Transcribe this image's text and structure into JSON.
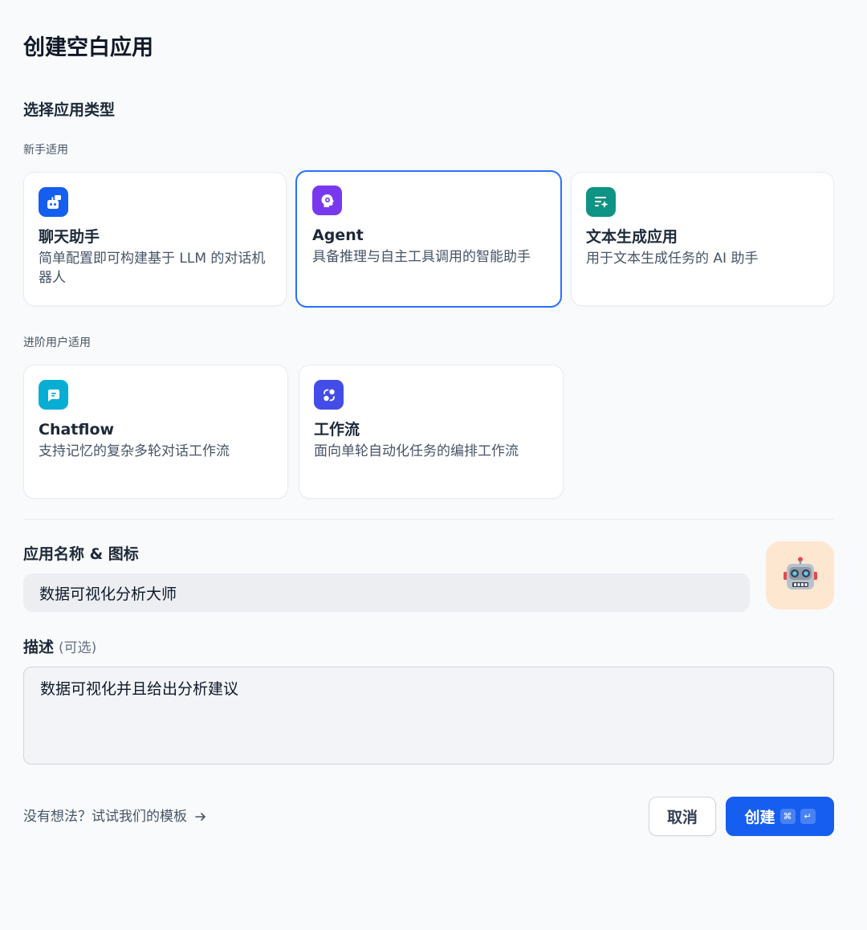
{
  "dialog": {
    "title": "创建空白应用",
    "section_title": "选择应用类型"
  },
  "groups": {
    "beginner": "新手适用",
    "advanced": "进阶用户适用"
  },
  "cards": {
    "chat": {
      "title": "聊天助手",
      "desc": "简单配置即可构建基于 LLM 的对话机器人",
      "icon_color": "#155eef",
      "icon": "robot-chat-icon"
    },
    "agent": {
      "title": "Agent",
      "desc": "具备推理与自主工具调用的智能助手",
      "icon_color": "#7839ee",
      "icon": "brain-gear-icon",
      "selected": true
    },
    "completion": {
      "title": "文本生成应用",
      "desc": "用于文本生成任务的 AI 助手",
      "icon_color": "#0e9384",
      "icon": "text-sparkle-icon"
    },
    "chatflow": {
      "title": "Chatflow",
      "desc": "支持记忆的复杂多轮对话工作流",
      "icon_color": "#06aed4",
      "icon": "chat-bubble-icon"
    },
    "workflow": {
      "title": "工作流",
      "desc": "面向单轮自动化任务的编排工作流",
      "icon_color": "#444ce7",
      "icon": "workflow-nodes-icon"
    }
  },
  "name_field": {
    "label": "应用名称 & 图标",
    "value": "数据可视化分析大师",
    "app_icon": "🤖",
    "app_icon_bg": "#fde7d1"
  },
  "description_field": {
    "label": "描述",
    "optional": "(可选)",
    "value": "数据可视化并且给出分析建议"
  },
  "footer": {
    "template_link": "没有想法？试试我们的模板",
    "cancel_label": "取消",
    "create_label": "创建",
    "shortcut_cmd": "⌘",
    "shortcut_enter": "↵"
  }
}
